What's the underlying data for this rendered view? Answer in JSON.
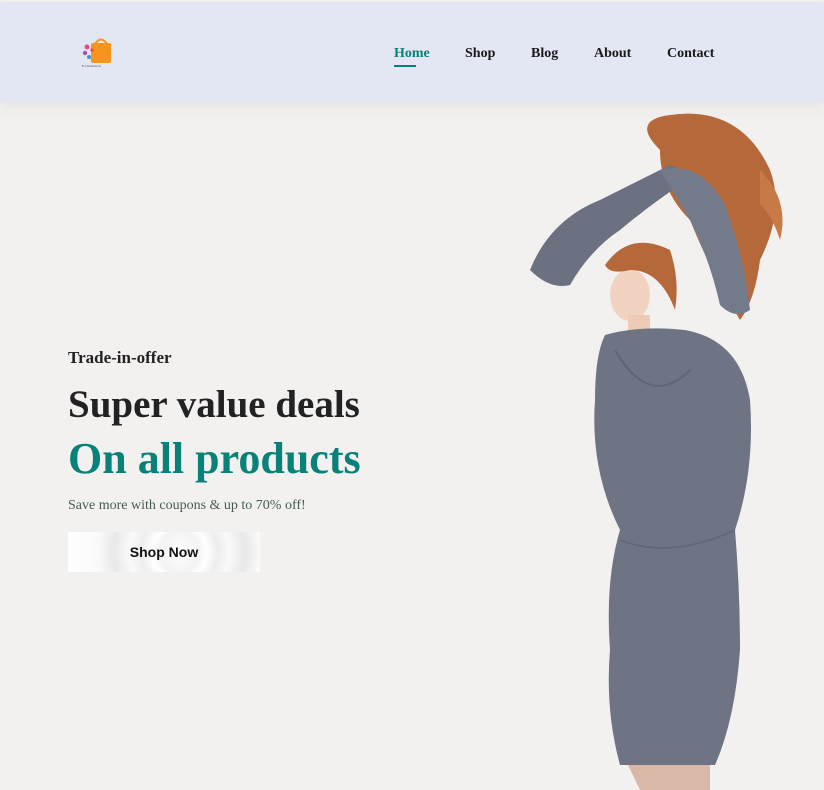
{
  "header": {
    "logo_text": "E-commerce",
    "nav": [
      {
        "label": "Home"
      },
      {
        "label": "Shop"
      },
      {
        "label": "Blog"
      },
      {
        "label": "About"
      },
      {
        "label": "Contact"
      }
    ],
    "active_nav": "Home",
    "accent_color": "#088178",
    "bg_color": "#e3e6f3"
  },
  "hero": {
    "subtitle": "Trade-in-offer",
    "title": "Super value deals",
    "title_highlight": "On all products",
    "description": "Save more with coupons & up to 70% off!",
    "button_label": "Shop Now",
    "bg_color": "#f3f0f0"
  }
}
